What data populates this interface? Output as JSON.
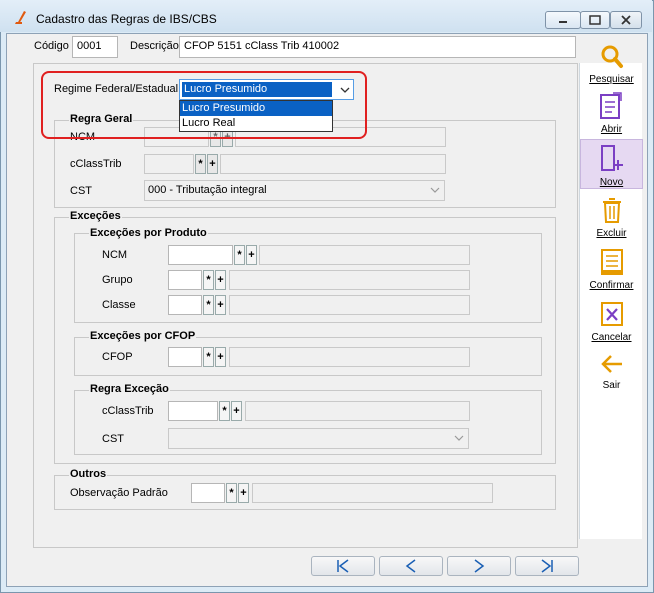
{
  "window": {
    "title": "Cadastro das Regras de IBS/CBS"
  },
  "header": {
    "codigo_label": "Código",
    "codigo_value": "0001",
    "descricao_label": "Descrição",
    "descricao_value": "CFOP 5151 cClass Trib 410002"
  },
  "regime": {
    "label": "Regime Federal/Estadual",
    "value": "Lucro Presumido",
    "options": [
      "Lucro Presumido",
      "Lucro Real"
    ]
  },
  "regra_geral": {
    "title": "Regra Geral",
    "ncm_label": "NCM",
    "cclass_label": "cClassTrib",
    "cst_label": "CST",
    "cst_value": "000 - Tributação integral"
  },
  "excecoes": {
    "title": "Exceções",
    "produto": {
      "title": "Exceções por Produto",
      "ncm_label": "NCM",
      "grupo_label": "Grupo",
      "classe_label": "Classe"
    },
    "cfop": {
      "title": "Exceções por CFOP",
      "cfop_label": "CFOP"
    },
    "regra": {
      "title": "Regra Exceção",
      "cclass_label": "cClassTrib",
      "cst_label": "CST"
    }
  },
  "outros": {
    "title": "Outros",
    "obs_label": "Observação Padrão"
  },
  "buttons": {
    "star": "*",
    "plus": "+"
  },
  "toolbar": {
    "pesquisar": "Pesquisar",
    "abrir": "Abrir",
    "novo": "Novo",
    "excluir": "Excluir",
    "confirmar": "Confirmar",
    "cancelar": "Cancelar",
    "sair": "Sair"
  },
  "colors": {
    "accent": "#0a61c4",
    "highlight": "#e02020",
    "icon_orange": "#e69b00",
    "icon_purple": "#7b3fc4",
    "icon_blue": "#1a5fb4"
  }
}
